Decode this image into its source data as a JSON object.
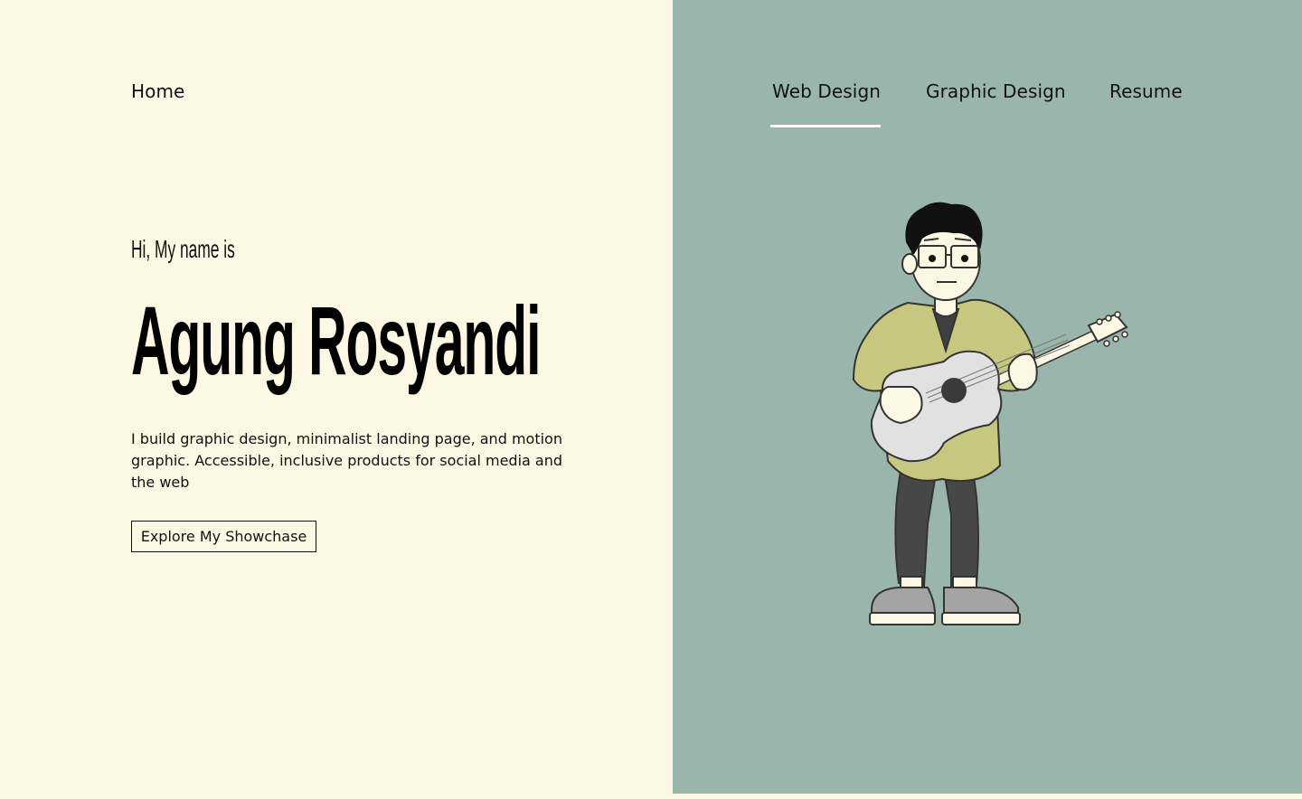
{
  "nav": {
    "home": "Home",
    "links": [
      {
        "label": "Web Design",
        "active": true
      },
      {
        "label": "Graphic Design",
        "active": false
      },
      {
        "label": "Resume",
        "active": false
      }
    ]
  },
  "hero": {
    "greeting": "Hi, My name is",
    "name": "Agung Rosyandi",
    "description": "I build graphic design, minimalist landing page, and motion graphic. Accessible, inclusive products for social media and the web",
    "cta_label": "Explore My Showchase"
  },
  "colors": {
    "left_background": "#fdf8e4",
    "right_background": "#9ab5ac",
    "active_underline": "#ffffff",
    "text": "#111111"
  },
  "illustration": {
    "icon": "guitarist-illustration"
  }
}
